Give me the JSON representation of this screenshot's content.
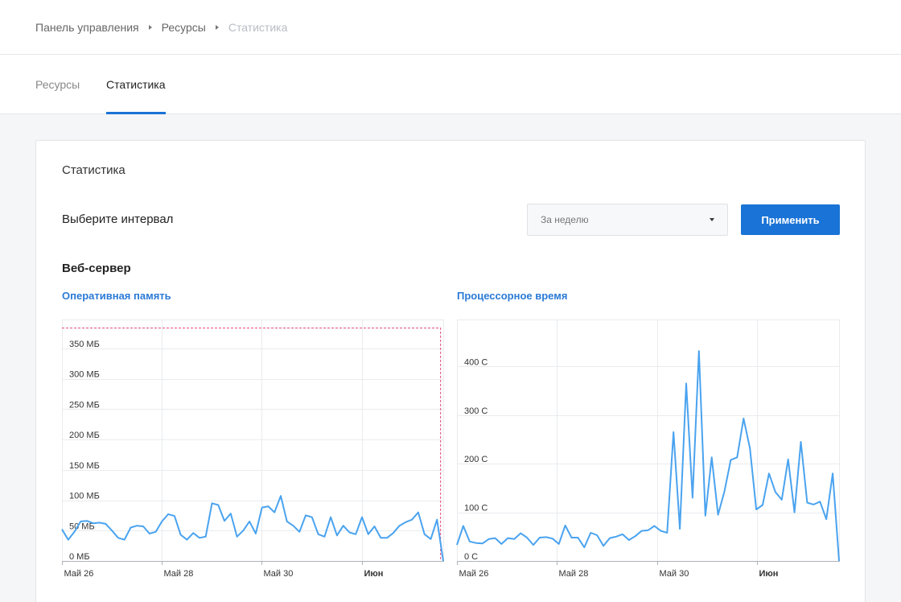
{
  "breadcrumb": {
    "items": [
      "Панель управления",
      "Ресурсы",
      "Статистика"
    ]
  },
  "tabs": [
    {
      "label": "Ресурсы",
      "active": false
    },
    {
      "label": "Статистика",
      "active": true
    }
  ],
  "card": {
    "title": "Статистика",
    "interval_label": "Выберите интервал",
    "interval_select": {
      "value": "За неделю"
    },
    "apply_label": "Применить",
    "section_title": "Веб-сервер"
  },
  "colors": {
    "accent": "#1a73d6",
    "series": "#4aa3ef",
    "limit": "#e0487a"
  },
  "chart_data": [
    {
      "type": "line",
      "title": "Оперативная память",
      "x_ticks": [
        {
          "label": "Май 26",
          "x": 0,
          "bold": false
        },
        {
          "label": "Май 28",
          "x": 2,
          "bold": false
        },
        {
          "label": "Май 30",
          "x": 4,
          "bold": false
        },
        {
          "label": "Июн",
          "x": 6,
          "bold": true
        }
      ],
      "xlim": [
        0,
        7.65
      ],
      "y_ticks": [
        {
          "label": "0 МБ",
          "v": 0
        },
        {
          "label": "50 МБ",
          "v": 50
        },
        {
          "label": "100 МБ",
          "v": 100
        },
        {
          "label": "150 МБ",
          "v": 150
        },
        {
          "label": "200 МБ",
          "v": 200
        },
        {
          "label": "250 МБ",
          "v": 250
        },
        {
          "label": "300 МБ",
          "v": 300
        },
        {
          "label": "350 МБ",
          "v": 350
        }
      ],
      "ylim": [
        0,
        400
      ],
      "limit_value": 384,
      "limit_end_x": 7.58,
      "series": [
        {
          "values": [
            52,
            35,
            48,
            65,
            66,
            62,
            63,
            61,
            50,
            38,
            35,
            55,
            58,
            57,
            45,
            48,
            65,
            77,
            74,
            43,
            35,
            46,
            38,
            40,
            95,
            92,
            66,
            78,
            40,
            50,
            65,
            45,
            88,
            90,
            80,
            107,
            65,
            58,
            48,
            75,
            72,
            44,
            40,
            72,
            42,
            58,
            47,
            44,
            72,
            44,
            57,
            38,
            38,
            46,
            58,
            64,
            68,
            80,
            44,
            36,
            68,
            0
          ]
        }
      ]
    },
    {
      "type": "line",
      "title": "Процессорное время",
      "x_ticks": [
        {
          "label": "Май 26",
          "x": 0,
          "bold": false
        },
        {
          "label": "Май 28",
          "x": 2,
          "bold": false
        },
        {
          "label": "Май 30",
          "x": 4,
          "bold": false
        },
        {
          "label": "Июн",
          "x": 6,
          "bold": true
        }
      ],
      "xlim": [
        0,
        7.65
      ],
      "y_ticks": [
        {
          "label": "0 С",
          "v": 0
        },
        {
          "label": "100 С",
          "v": 100
        },
        {
          "label": "200 С",
          "v": 200
        },
        {
          "label": "300 С",
          "v": 300
        },
        {
          "label": "400 С",
          "v": 400
        }
      ],
      "ylim": [
        0,
        500
      ],
      "series": [
        {
          "values": [
            33,
            72,
            40,
            37,
            36,
            45,
            47,
            35,
            47,
            45,
            57,
            48,
            33,
            48,
            49,
            46,
            35,
            73,
            48,
            48,
            28,
            58,
            53,
            31,
            47,
            50,
            55,
            43,
            51,
            62,
            63,
            72,
            62,
            58,
            265,
            66,
            365,
            130,
            432,
            93,
            213,
            95,
            143,
            208,
            213,
            293,
            232,
            106,
            115,
            180,
            142,
            126,
            209,
            100,
            245,
            120,
            116,
            122,
            86,
            180,
            0
          ]
        }
      ]
    }
  ]
}
